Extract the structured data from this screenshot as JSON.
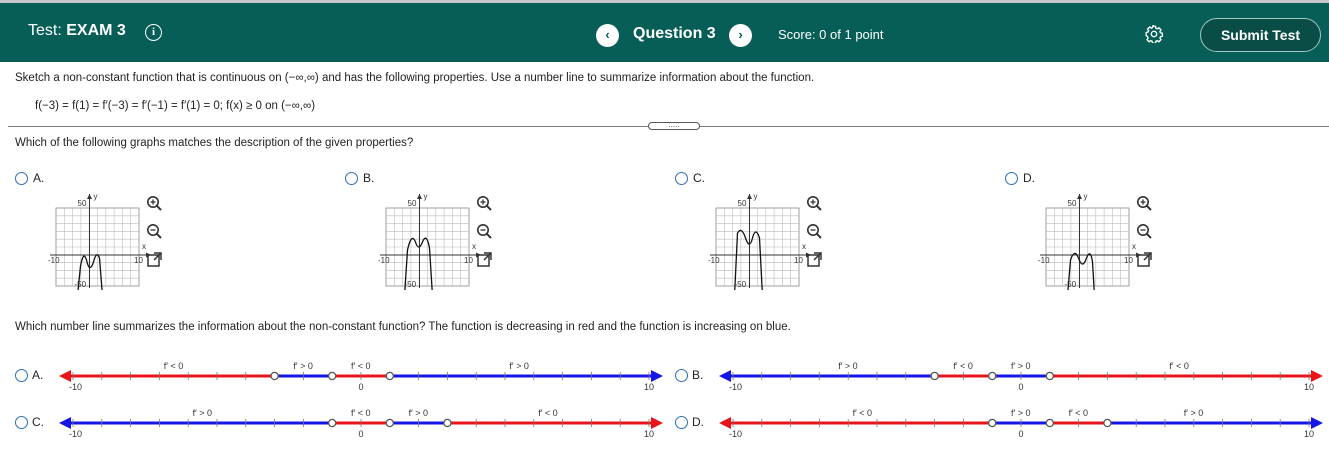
{
  "header": {
    "test_label": "Test:",
    "test_name": "EXAM 3",
    "prev_glyph": "‹",
    "question_label": "Question 3",
    "next_glyph": "›",
    "score": "Score: 0 of 1 point",
    "submit_label": "Submit Test"
  },
  "problem": {
    "instructions": "Sketch a non-constant function that is continuous on (−∞,∞) and has the following properties. Use a number line to summarize information about the function.",
    "properties": "f(−3) = f(1) = f′(−3) = f′(−1) = f′(1) = 0; f(x) ≥ 0 on (−∞,∞)",
    "divider_handle": "....."
  },
  "graph_question": {
    "prompt": "Which of the following graphs matches the description of the given properties?",
    "options": [
      {
        "letter": "A.",
        "y_top": "50",
        "y_bottom": "-50",
        "x_left": "-10",
        "x_right": "10",
        "x_axis": "x",
        "y_axis": "y"
      },
      {
        "letter": "B.",
        "y_top": "50",
        "y_bottom": "-50",
        "x_left": "-10",
        "x_right": "10",
        "x_axis": "x",
        "y_axis": "y"
      },
      {
        "letter": "C.",
        "y_top": "50",
        "y_bottom": "-50",
        "x_left": "-10",
        "x_right": "10",
        "x_axis": "x",
        "y_axis": "y"
      },
      {
        "letter": "D.",
        "y_top": "50",
        "y_bottom": "-50",
        "x_left": "-10",
        "x_right": "10",
        "x_axis": "x",
        "y_axis": "y"
      }
    ],
    "tool_icons": [
      "zoom-in-icon",
      "zoom-out-icon",
      "expand-icon"
    ]
  },
  "numberline_question": {
    "prompt": "Which number line summarizes the information about the non-constant function? The function is decreasing in red and the function is increasing on blue.",
    "axis_labels": {
      "left": "-10",
      "zero": "0",
      "right": "10"
    },
    "colors": {
      "decreasing": "#e8141a",
      "increasing": "#1515e6"
    },
    "options": [
      {
        "letter": "A.",
        "segments": [
          {
            "from": -10,
            "to": -3,
            "color": "red"
          },
          {
            "from": -3,
            "to": -1,
            "color": "blue"
          },
          {
            "from": -1,
            "to": 1,
            "color": "red"
          },
          {
            "from": 1,
            "to": 10,
            "color": "blue"
          }
        ],
        "points": [
          -3,
          -1,
          1
        ],
        "labels": [
          {
            "x": -6.5,
            "text": "f′ < 0"
          },
          {
            "x": -2,
            "text": "f′ > 0"
          },
          {
            "x": 0,
            "text": "f′ < 0"
          },
          {
            "x": 5.5,
            "text": "f′ > 0"
          }
        ]
      },
      {
        "letter": "B.",
        "segments": [
          {
            "from": -10,
            "to": -3,
            "color": "blue"
          },
          {
            "from": -3,
            "to": -1,
            "color": "red"
          },
          {
            "from": -1,
            "to": 1,
            "color": "blue"
          },
          {
            "from": 1,
            "to": 10,
            "color": "red"
          }
        ],
        "points": [
          -3,
          -1,
          1
        ],
        "labels": [
          {
            "x": -6,
            "text": "f′ > 0"
          },
          {
            "x": -2,
            "text": "f′ < 0"
          },
          {
            "x": 0,
            "text": "f′ > 0"
          },
          {
            "x": 5.5,
            "text": "f′ < 0"
          }
        ]
      },
      {
        "letter": "C.",
        "segments": [
          {
            "from": -10,
            "to": -1,
            "color": "blue"
          },
          {
            "from": -1,
            "to": 1,
            "color": "red"
          },
          {
            "from": 1,
            "to": 3,
            "color": "blue"
          },
          {
            "from": 3,
            "to": 10,
            "color": "red"
          }
        ],
        "points": [
          -1,
          1,
          3
        ],
        "labels": [
          {
            "x": -5.5,
            "text": "f′ > 0"
          },
          {
            "x": 0,
            "text": "f′ < 0"
          },
          {
            "x": 2,
            "text": "f′ > 0"
          },
          {
            "x": 6.5,
            "text": "f′ < 0"
          }
        ]
      },
      {
        "letter": "D.",
        "segments": [
          {
            "from": -10,
            "to": -1,
            "color": "red"
          },
          {
            "from": -1,
            "to": 1,
            "color": "blue"
          },
          {
            "from": 1,
            "to": 3,
            "color": "red"
          },
          {
            "from": 3,
            "to": 10,
            "color": "blue"
          }
        ],
        "points": [
          -1,
          1,
          3
        ],
        "labels": [
          {
            "x": -5.5,
            "text": "f′ < 0"
          },
          {
            "x": 0,
            "text": "f′ > 0"
          },
          {
            "x": 2,
            "text": "f′ < 0"
          },
          {
            "x": 6,
            "text": "f′ > 0"
          }
        ]
      }
    ]
  }
}
